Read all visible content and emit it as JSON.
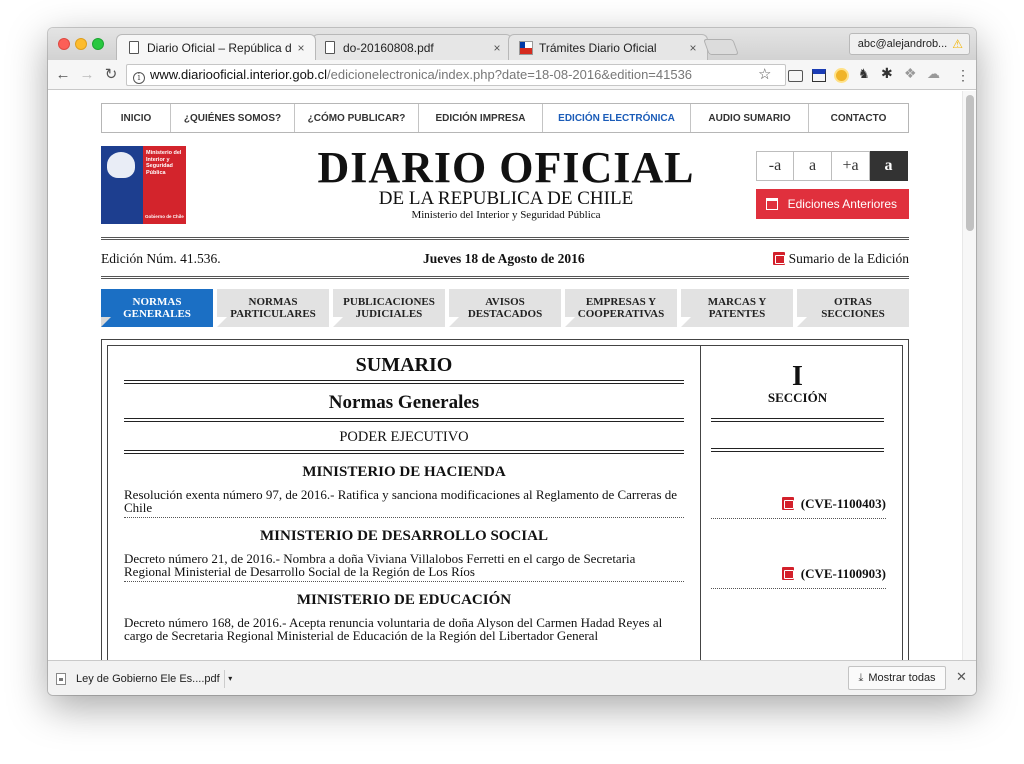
{
  "browser": {
    "tabs": [
      {
        "title": "Diario Oficial – República de Chi",
        "icon": "page-icon",
        "active": true
      },
      {
        "title": "do-20160808.pdf",
        "icon": "page-icon",
        "active": false
      },
      {
        "title": "Trámites Diario Oficial",
        "icon": "chile-flag-icon",
        "active": false
      }
    ],
    "tab_close_glyph": "×",
    "profile_label": "abc@alejandrob...",
    "url_host": "www.diariooficial.interior.gob.cl",
    "url_path": "/edicionelectronica/index.php?date=18-08-2016&edition=41536"
  },
  "site": {
    "nav": [
      {
        "label": "INICIO",
        "active": false
      },
      {
        "label": "¿QUIÉNES SOMOS?",
        "active": false
      },
      {
        "label": "¿CÓMO PUBLICAR?",
        "active": false
      },
      {
        "label": "EDICIÓN IMPRESA",
        "active": false
      },
      {
        "label": "EDICIÓN ELECTRÓNICA",
        "active": true
      },
      {
        "label": "AUDIO SUMARIO",
        "active": false
      },
      {
        "label": "CONTACTO",
        "active": false
      }
    ],
    "logo": {
      "text": "Ministerio del Interior y Seguridad Pública",
      "footer": "Gobierno de Chile"
    },
    "masthead": {
      "title": "DIARIO OFICIAL",
      "subtitle": "DE LA REPUBLICA DE CHILE",
      "ministry": "Ministerio del Interior y Seguridad Pública"
    },
    "font_controls": [
      "-a",
      "a",
      "+a",
      "a"
    ],
    "prev_editions_label": "Ediciones Anteriores",
    "edition": {
      "number": "Edición Núm. 41.536.",
      "date": "Jueves 18 de Agosto de 2016",
      "summary_link": "Sumario de la Edición"
    },
    "section_tabs": [
      {
        "line1": "NORMAS",
        "line2": "GENERALES",
        "active": true
      },
      {
        "line1": "NORMAS",
        "line2": "PARTICULARES",
        "active": false
      },
      {
        "line1": "PUBLICACIONES",
        "line2": "JUDICIALES",
        "active": false
      },
      {
        "line1": "AVISOS",
        "line2": "DESTACADOS",
        "active": false
      },
      {
        "line1": "EMPRESAS Y",
        "line2": "COOPERATIVAS",
        "active": false
      },
      {
        "line1": "MARCAS Y",
        "line2": "PATENTES",
        "active": false
      },
      {
        "line1": "OTRAS",
        "line2": "SECCIONES",
        "active": false
      }
    ],
    "sumario": {
      "title": "SUMARIO",
      "subtitle": "Normas Generales",
      "branch": "PODER EJECUTIVO",
      "section_roman": "I",
      "section_label": "SECCIÓN",
      "entries": [
        {
          "ministry": "MINISTERIO DE HACIENDA",
          "text": "Resolución exenta número 97, de 2016.- Ratifica y sanciona modificaciones al Reglamento de Carreras de Chile",
          "cve": "(CVE-1100403)"
        },
        {
          "ministry": "MINISTERIO DE DESARROLLO SOCIAL",
          "text": "Decreto número 21, de 2016.- Nombra a doña Viviana Villalobos Ferretti en el cargo de Secretaria Regional Ministerial de Desarrollo Social de la Región de Los Ríos",
          "cve": "(CVE-1100903)"
        },
        {
          "ministry": "MINISTERIO DE EDUCACIÓN",
          "text": "Decreto número 168, de 2016.- Acepta renuncia voluntaria de doña Alyson del Carmen Hadad Reyes al cargo de Secretaria Regional Ministerial de Educación de la Región del Libertador General",
          "cve": ""
        }
      ]
    }
  },
  "downloads": {
    "file": "Ley de Gobierno Ele Es....pdf",
    "show_all": "Mostrar todas"
  },
  "colors": {
    "accent_blue": "#1b6fc4",
    "nav_active": "#1b5cb8",
    "prev_editions_red": "#e0303d"
  }
}
